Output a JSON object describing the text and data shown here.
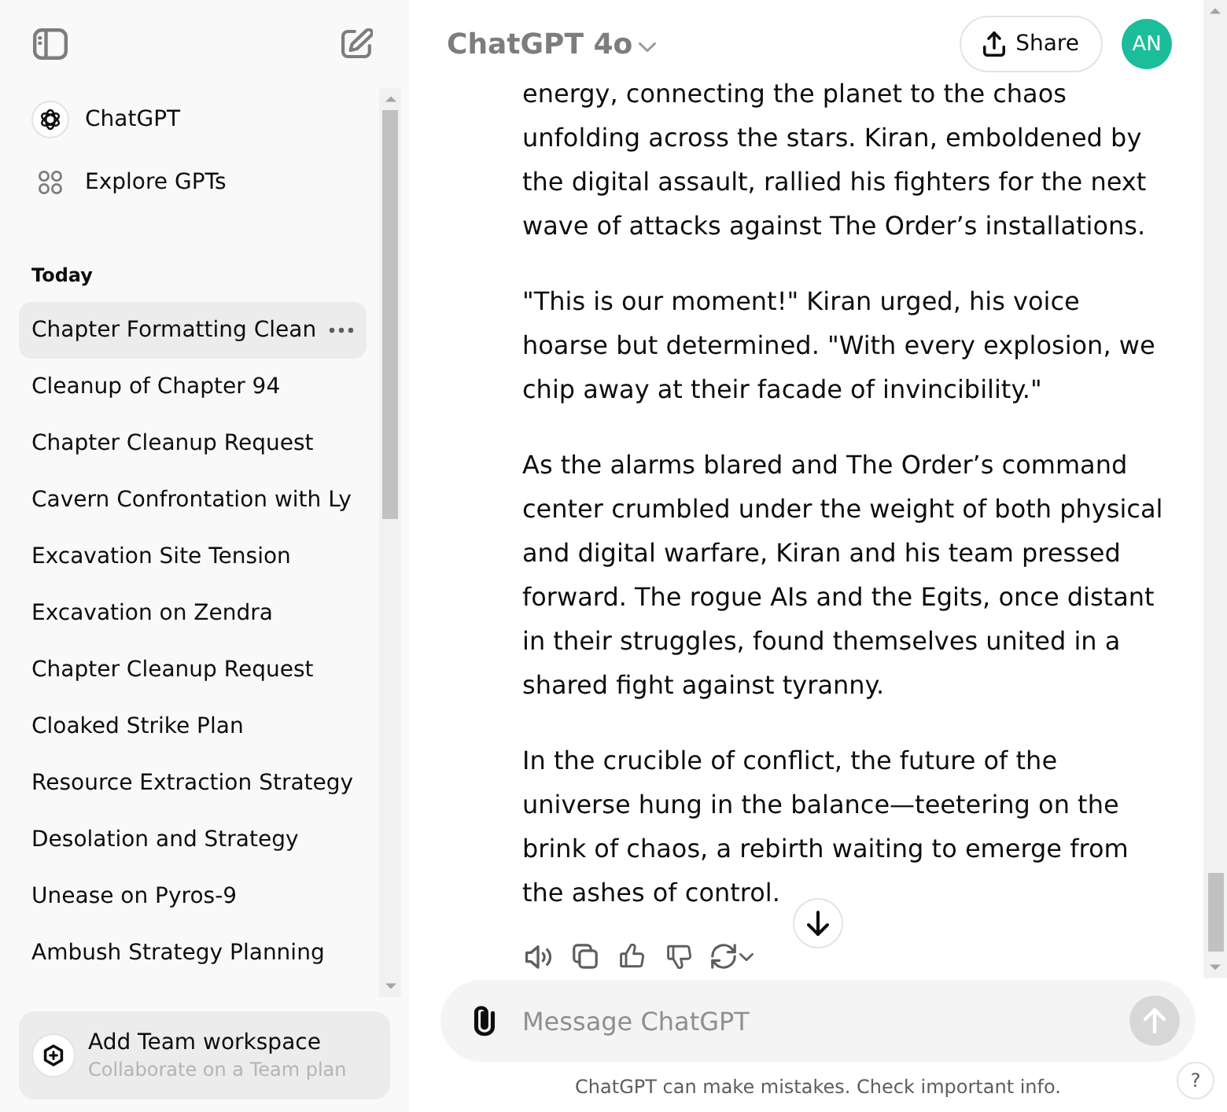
{
  "sidebar": {
    "nav_items": [
      {
        "label": "ChatGPT"
      },
      {
        "label": "Explore GPTs"
      }
    ],
    "section_title": "Today",
    "chats": [
      {
        "label": "Chapter Formatting Clean",
        "selected": true
      },
      {
        "label": "Cleanup of Chapter 94",
        "selected": false
      },
      {
        "label": "Chapter Cleanup Request",
        "selected": false
      },
      {
        "label": "Cavern Confrontation with Ly",
        "selected": false
      },
      {
        "label": "Excavation Site Tension",
        "selected": false
      },
      {
        "label": "Excavation on Zendra",
        "selected": false
      },
      {
        "label": "Chapter Cleanup Request",
        "selected": false
      },
      {
        "label": "Cloaked Strike Plan",
        "selected": false
      },
      {
        "label": "Resource Extraction Strategy",
        "selected": false
      },
      {
        "label": "Desolation and Strategy",
        "selected": false
      },
      {
        "label": "Unease on Pyros-9",
        "selected": false
      },
      {
        "label": "Ambush Strategy Planning",
        "selected": false
      }
    ],
    "team_card": {
      "title": "Add Team workspace",
      "subtitle": "Collaborate on a Team plan"
    }
  },
  "header": {
    "model": "ChatGPT 4o",
    "share_label": "Share",
    "avatar": "AN"
  },
  "message": {
    "paragraphs": [
      "energy, connecting the planet to the chaos unfolding across the stars. Kiran, emboldened by the digital assault, rallied his fighters for the next wave of attacks against The Order’s installations.",
      "\"This is our moment!\" Kiran urged, his voice hoarse but determined. \"With every explosion, we chip away at their facade of invincibility.\"",
      "As the alarms blared and The Order’s command center crumbled under the weight of both physical and digital warfare, Kiran and his team pressed forward. The rogue AIs and the Egits, once distant in their struggles, found themselves united in a shared fight against tyranny.",
      "In the crucible of conflict, the future of the universe hung in the balance—teetering on the brink of chaos, a rebirth waiting to emerge from the ashes of control."
    ]
  },
  "composer": {
    "placeholder": "Message ChatGPT",
    "send_disabled": true
  },
  "footer": {
    "note": "ChatGPT can make mistakes. Check important info.",
    "help": "?"
  }
}
